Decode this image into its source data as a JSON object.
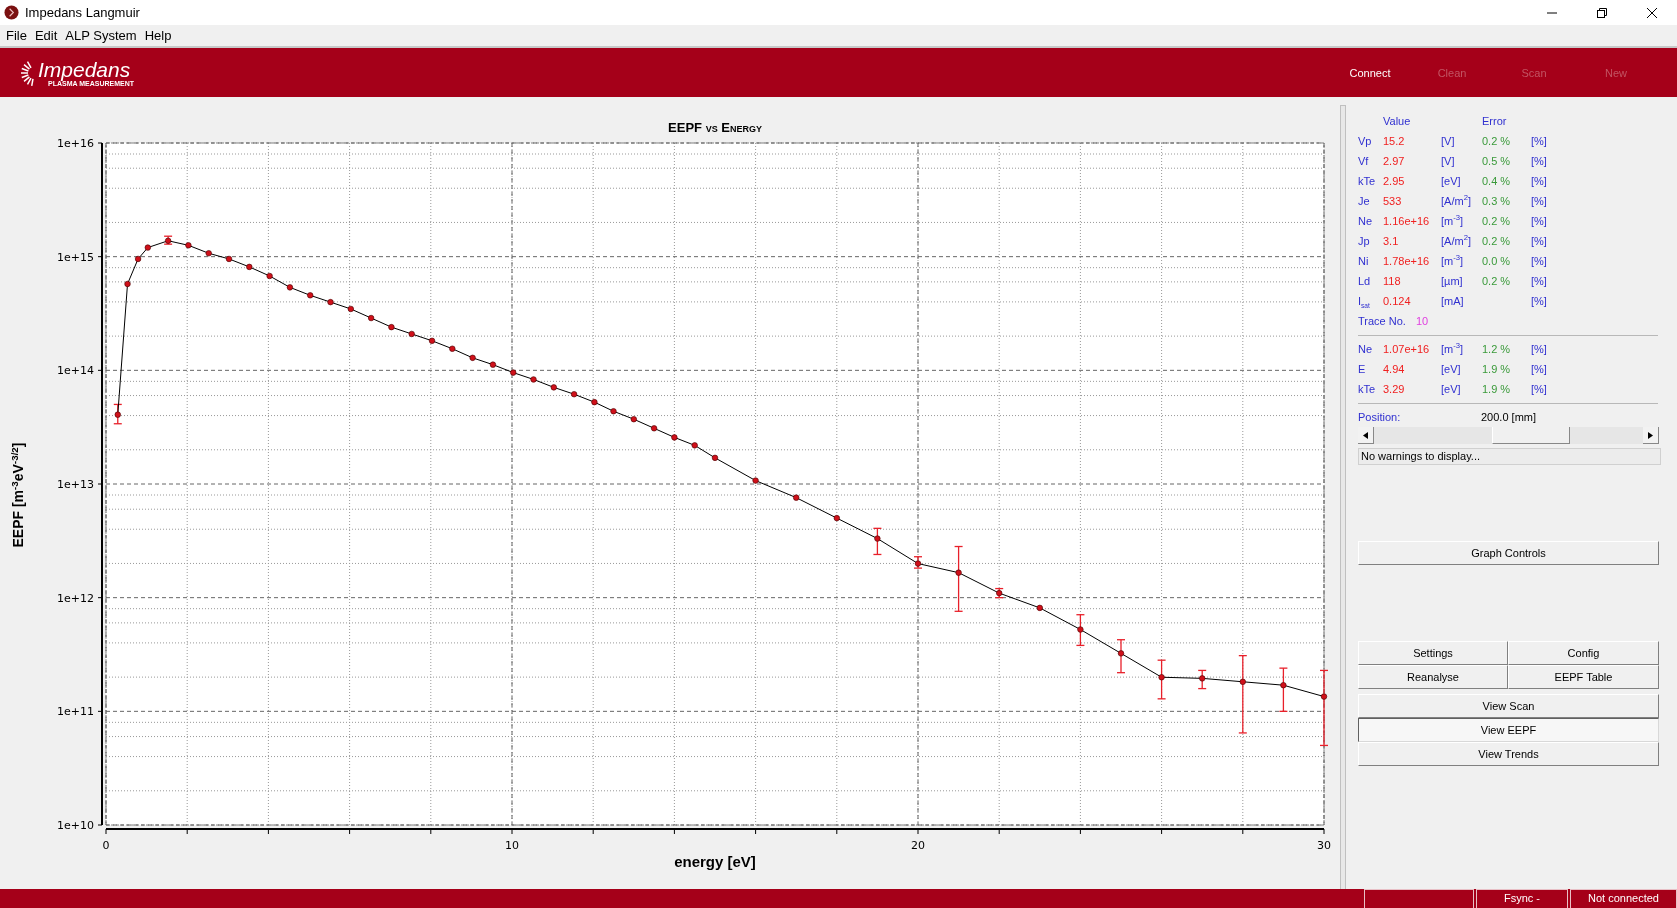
{
  "window": {
    "title": "Impedans Langmuir"
  },
  "menu": [
    "File",
    "Edit",
    "ALP System",
    "Help"
  ],
  "header": {
    "logo": "Impedans",
    "tagline": "PLASMA MEASUREMENT",
    "actions": [
      {
        "label": "Connect",
        "disabled": false
      },
      {
        "label": "Clean",
        "disabled": true
      },
      {
        "label": "Scan",
        "disabled": true
      },
      {
        "label": "New",
        "disabled": true
      }
    ]
  },
  "chart": {
    "title": "EEPF vs Energy",
    "xlabel": "energy [eV]",
    "ylabel": "EEPF [m$^{-3}$eV$^{-3/2}$]",
    "x_tick_labels": [
      "0",
      "10",
      "20",
      "30"
    ],
    "y_tick_labels": [
      "1e+16",
      "1e+15",
      "1e+14",
      "1e+13",
      "1e+12",
      "1e+11",
      "1e+10"
    ]
  },
  "parameters": {
    "value_header": "Value",
    "error_header": "Error",
    "rows": [
      {
        "name": "Vp",
        "value": "15.2",
        "unit": "[V]",
        "error": "0.2 %",
        "error_unit": "[%]"
      },
      {
        "name": "Vf",
        "value": "2.97",
        "unit": "[V]",
        "error": "0.5 %",
        "error_unit": "[%]"
      },
      {
        "name": "kTe",
        "value": "2.95",
        "unit": "[eV]",
        "error": "0.4 %",
        "error_unit": "[%]"
      },
      {
        "name": "Je",
        "value": "533",
        "unit": "[A/m$^{2}$]",
        "error": "0.3 %",
        "error_unit": "[%]"
      },
      {
        "name": "Ne",
        "value": "1.16e+16",
        "unit": "[m$^{-3}$]",
        "error": "0.2 %",
        "error_unit": "[%]"
      },
      {
        "name": "Jp",
        "value": "3.1",
        "unit": "[A/m$^{2}$]",
        "error": "0.2 %",
        "error_unit": "[%]"
      },
      {
        "name": "Ni",
        "value": "1.78e+16",
        "unit": "[m$^{-3}$]",
        "error": "0.0 %",
        "error_unit": "[%]"
      },
      {
        "name": "Ld",
        "value": "118",
        "unit": "[µm]",
        "error": "0.2 %",
        "error_unit": "[%]"
      },
      {
        "name": "I$_{sat}$",
        "value": "0.124",
        "unit": "[mA]",
        "error_unit": "[%]"
      }
    ],
    "trace": {
      "label": "Trace No.",
      "value": "10"
    },
    "eepf_rows": [
      {
        "name": "Ne",
        "value": "1.07e+16",
        "unit": "[m$^{-3}$]",
        "error": "1.2 %",
        "error_unit": "[%]"
      },
      {
        "name": "E",
        "value": "4.94",
        "unit": "[eV]",
        "error": "1.9 %",
        "error_unit": "[%]"
      },
      {
        "name": "kTe",
        "value": "3.29",
        "unit": "[eV]",
        "error": "1.9 %",
        "error_unit": "[%]"
      }
    ]
  },
  "position": {
    "label": "Position:",
    "value": "200.0 [mm]"
  },
  "warnings": "No warnings to display...",
  "graph_controls": "Graph Controls",
  "button_grid": [
    "Settings",
    "Config",
    "Reanalyse",
    "EEPF Table"
  ],
  "view_buttons": [
    {
      "label": "View Scan",
      "selected": false
    },
    {
      "label": "View EEPF",
      "selected": true
    },
    {
      "label": "View Trends",
      "selected": false
    }
  ],
  "status_bar": [
    "Fsync -",
    "Not connected"
  ]
}
